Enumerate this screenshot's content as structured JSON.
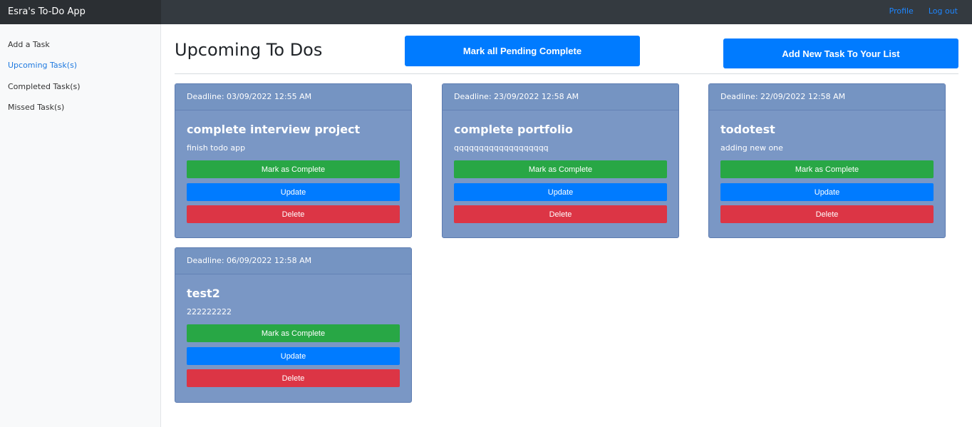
{
  "app": {
    "title": "Esra's To-Do App"
  },
  "topnav": {
    "profile": "Profile",
    "logout": "Log out"
  },
  "sidebar": {
    "items": [
      {
        "label": "Add a Task"
      },
      {
        "label": "Upcoming Task(s)",
        "active": true
      },
      {
        "label": "Completed Task(s)"
      },
      {
        "label": "Missed Task(s)"
      }
    ]
  },
  "main": {
    "title": "Upcoming To Dos",
    "mark_all_label": "Mark all Pending Complete",
    "add_task_label": "Add New Task To Your List"
  },
  "tasks": [
    {
      "deadline": "Deadline: 03/09/2022 12:55 AM",
      "title": "complete interview project",
      "description": "finish todo app",
      "complete_label": "Mark as Complete",
      "update_label": "Update",
      "delete_label": "Delete"
    },
    {
      "deadline": "Deadline: 23/09/2022 12:58 AM",
      "title": "complete portfolio",
      "description": "qqqqqqqqqqqqqqqqqqq",
      "complete_label": "Mark as Complete",
      "update_label": "Update",
      "delete_label": "Delete"
    },
    {
      "deadline": "Deadline: 22/09/2022 12:58 AM",
      "title": "todotest",
      "description": "adding new one",
      "complete_label": "Mark as Complete",
      "update_label": "Update",
      "delete_label": "Delete"
    },
    {
      "deadline": "Deadline: 06/09/2022 12:58 AM",
      "title": "test2",
      "description": "222222222",
      "complete_label": "Mark as Complete",
      "update_label": "Update",
      "delete_label": "Delete"
    }
  ],
  "colors": {
    "navbar": "#343a40",
    "card": "#7a97c5",
    "primary": "#007bff",
    "success": "#28a745",
    "danger": "#dc3545"
  }
}
